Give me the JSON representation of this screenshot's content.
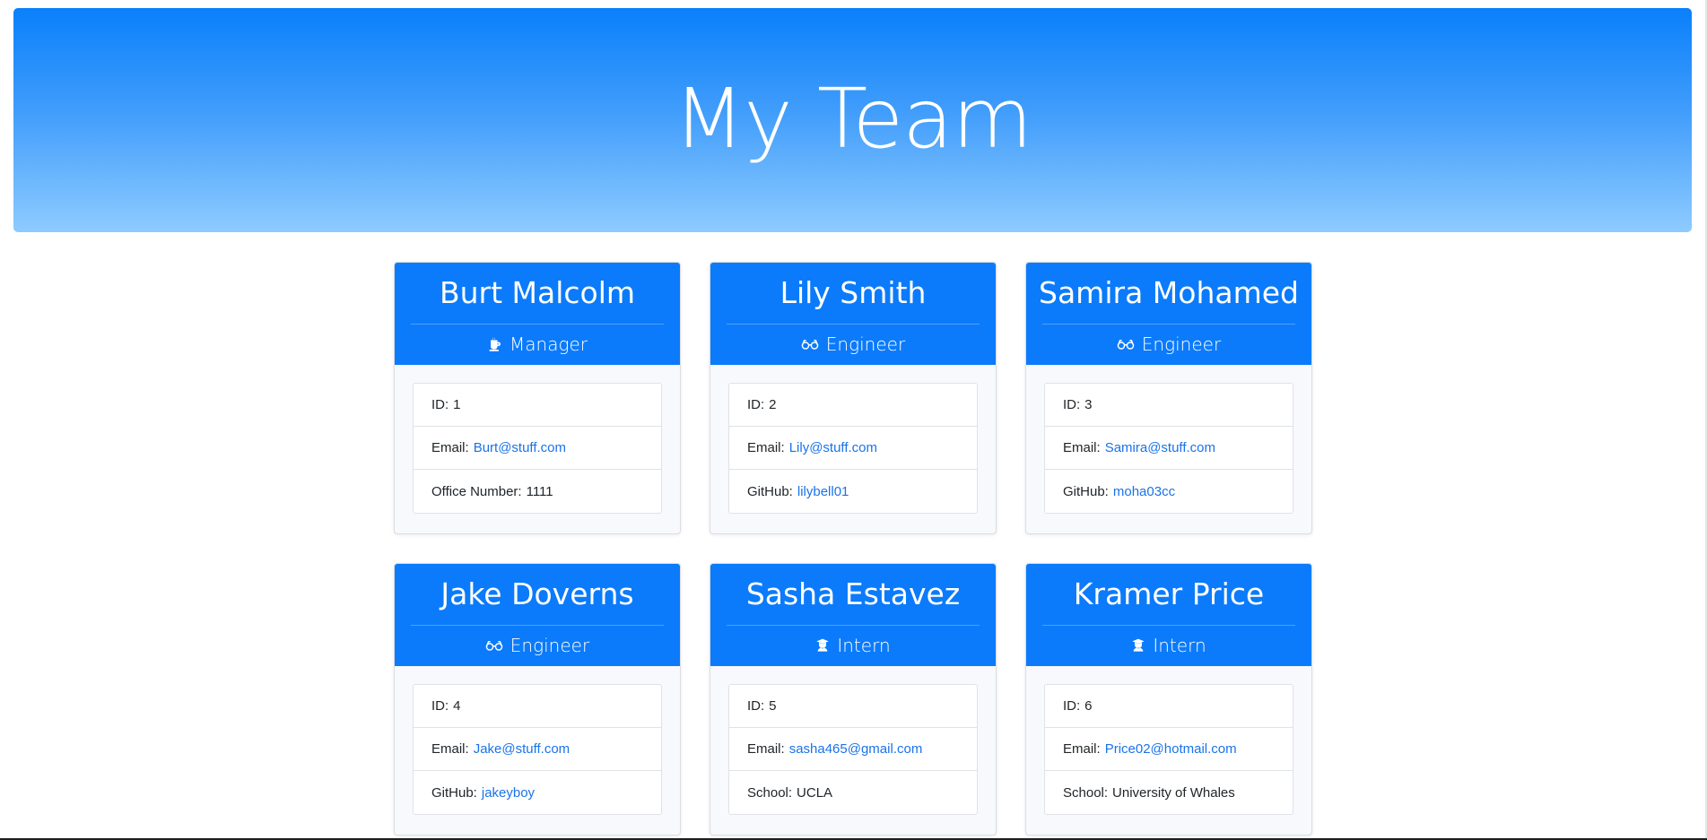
{
  "header": {
    "title": "My Team"
  },
  "team": [
    {
      "name": "Burt Malcolm",
      "role": "Manager",
      "role_icon": "mug-icon",
      "id_label": "ID:",
      "id": "1",
      "email_label": "Email:",
      "email": "Burt@stuff.com",
      "extra_label": "Office Number:",
      "extra": "1111",
      "extra_is_link": false
    },
    {
      "name": "Lily Smith",
      "role": "Engineer",
      "role_icon": "glasses-icon",
      "id_label": "ID:",
      "id": "2",
      "email_label": "Email:",
      "email": "Lily@stuff.com",
      "extra_label": "GitHub:",
      "extra": "lilybell01",
      "extra_is_link": true
    },
    {
      "name": "Samira Mohamed",
      "role": "Engineer",
      "role_icon": "glasses-icon",
      "id_label": "ID:",
      "id": "3",
      "email_label": "Email:",
      "email": "Samira@stuff.com",
      "extra_label": "GitHub:",
      "extra": "moha03cc",
      "extra_is_link": true
    },
    {
      "name": "Jake Doverns",
      "role": "Engineer",
      "role_icon": "glasses-icon",
      "id_label": "ID:",
      "id": "4",
      "email_label": "Email:",
      "email": "Jake@stuff.com",
      "extra_label": "GitHub:",
      "extra": "jakeyboy",
      "extra_is_link": true
    },
    {
      "name": "Sasha Estavez",
      "role": "Intern",
      "role_icon": "graduate-icon",
      "id_label": "ID:",
      "id": "5",
      "email_label": "Email:",
      "email": "sasha465@gmail.com",
      "extra_label": "School:",
      "extra": "UCLA",
      "extra_is_link": false
    },
    {
      "name": "Kramer Price",
      "role": "Intern",
      "role_icon": "graduate-icon",
      "id_label": "ID:",
      "id": "6",
      "email_label": "Email:",
      "email": "Price02@hotmail.com",
      "extra_label": "School:",
      "extra": "University of Whales",
      "extra_is_link": false
    }
  ],
  "colors": {
    "header_blue": "#0b7bfb",
    "link_blue": "#1a73e8",
    "jumbotron_top": "#0a80fb",
    "jumbotron_bottom": "#8ecbff"
  }
}
